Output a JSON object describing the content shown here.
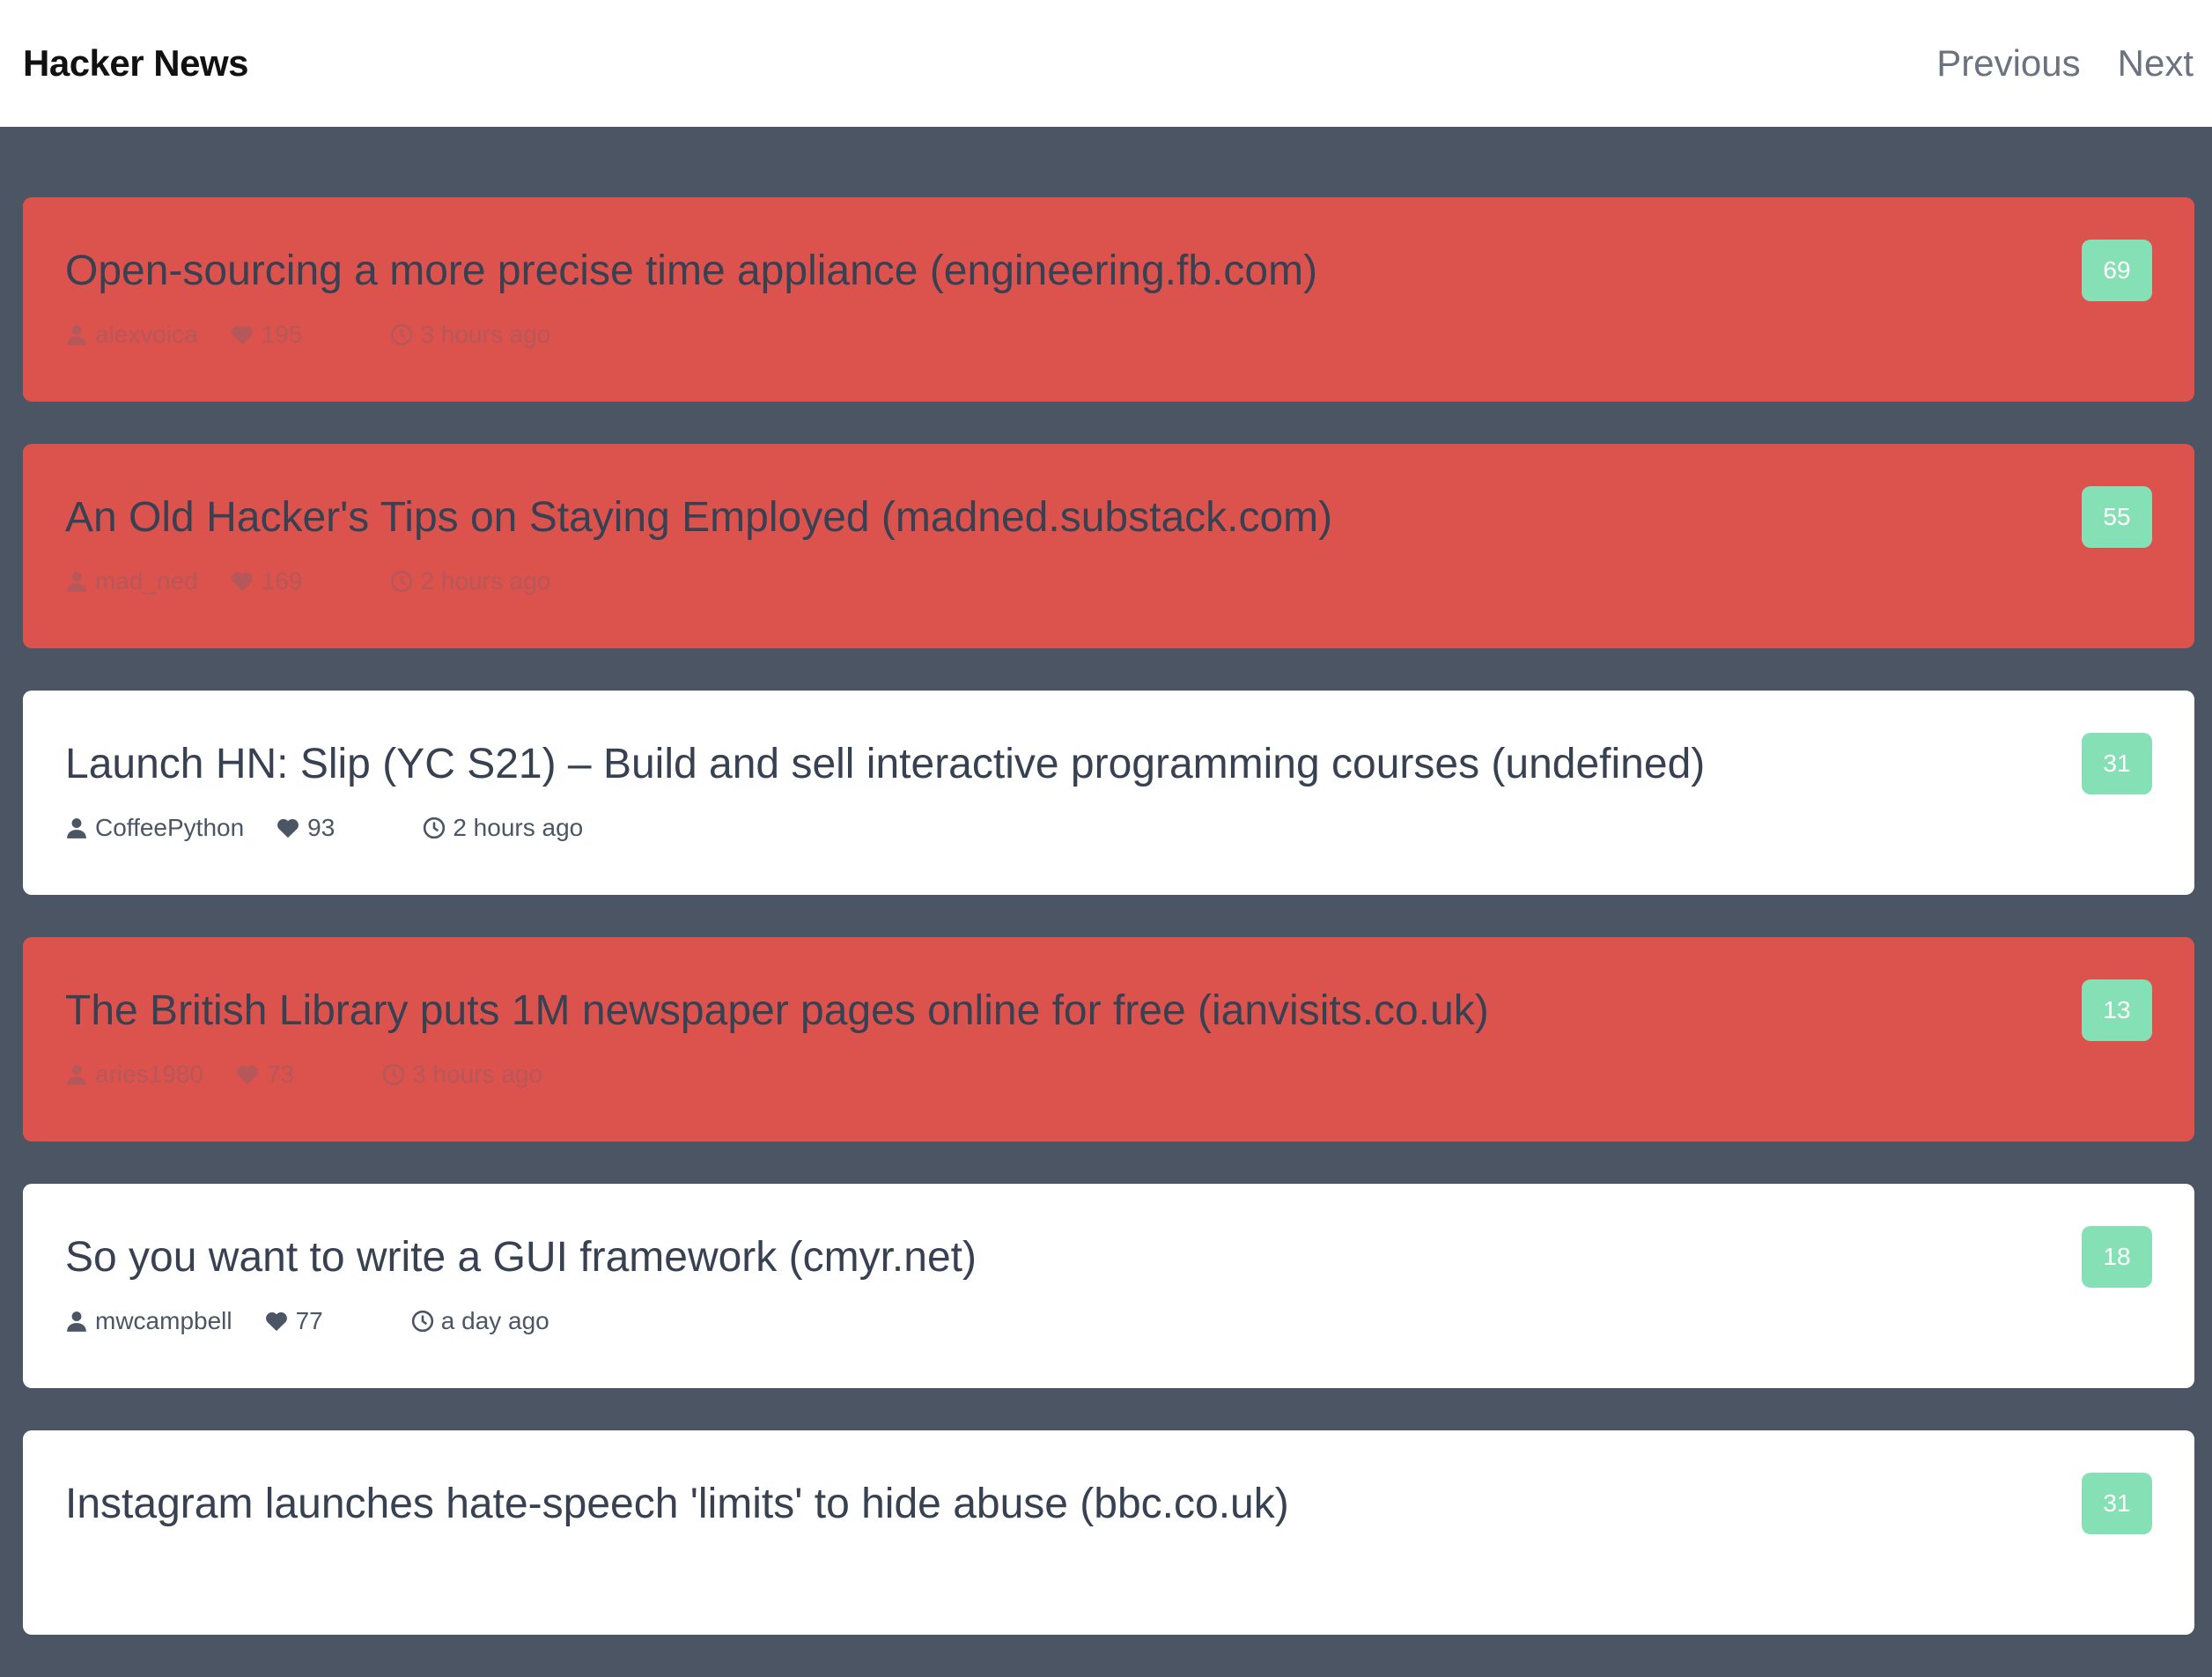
{
  "app": {
    "title": "Hacker News"
  },
  "nav": {
    "previous": "Previous",
    "next": "Next"
  },
  "colors": {
    "hot_card": "#dc524d",
    "normal_card": "#ffffff",
    "badge": "#86e0b5",
    "background": "#4b5563"
  },
  "stories": [
    {
      "title": "Open-sourcing a more precise time appliance (engineering.fb.com)",
      "author": "alexvoica",
      "points": "195",
      "time": "3 hours ago",
      "comments": "69",
      "hot": true
    },
    {
      "title": "An Old Hacker's Tips on Staying Employed (madned.substack.com)",
      "author": "mad_ned",
      "points": "169",
      "time": "2 hours ago",
      "comments": "55",
      "hot": true
    },
    {
      "title": "Launch HN: Slip (YC S21) – Build and sell interactive programming courses (undefined)",
      "author": "CoffeePython",
      "points": "93",
      "time": "2 hours ago",
      "comments": "31",
      "hot": false
    },
    {
      "title": "The British Library puts 1M newspaper pages online for free (ianvisits.co.uk)",
      "author": "aries1980",
      "points": "73",
      "time": "3 hours ago",
      "comments": "13",
      "hot": true
    },
    {
      "title": "So you want to write a GUI framework (cmyr.net)",
      "author": "mwcampbell",
      "points": "77",
      "time": "a day ago",
      "comments": "18",
      "hot": false
    },
    {
      "title": "Instagram launches hate-speech 'limits' to hide abuse (bbc.co.uk)",
      "author": "",
      "points": "",
      "time": "",
      "comments": "31",
      "hot": false
    }
  ]
}
